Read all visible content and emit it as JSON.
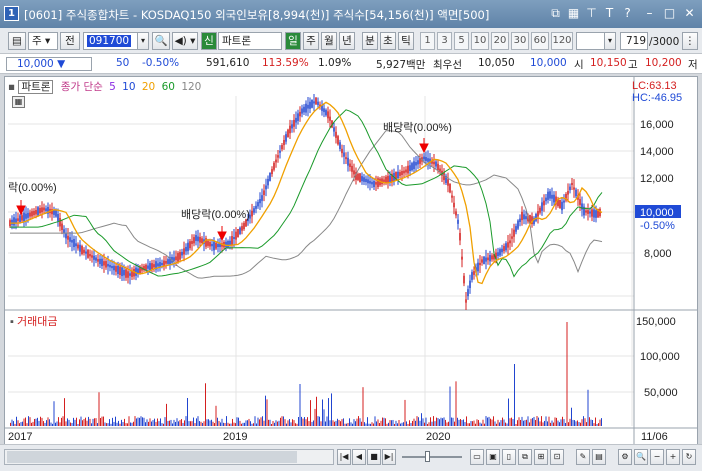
{
  "window": {
    "badge": "1",
    "title": "[0601] 주식종합차트 - KOSDAQ150 외국인보유[8,994(천)] 주식수[54,156(천)] 액면[500]"
  },
  "toolbar": {
    "market": "주",
    "market_select": "전",
    "code": "091700",
    "chart_type_badge": "신",
    "name": "파트론",
    "periods": [
      "일",
      "주",
      "월",
      "년",
      "분",
      "초",
      "틱"
    ],
    "intervals": [
      "1",
      "3",
      "5",
      "10",
      "20",
      "30",
      "60",
      "120"
    ],
    "count": "719",
    "total": "/3000"
  },
  "quote": {
    "price": "10,000",
    "change": "50",
    "change_pct": "-0.50%",
    "volume": "591,610",
    "volume_ratio": "113.59%",
    "turnover": "1.09%",
    "amount": "5,927백만",
    "best_bid_label": "최우선",
    "best_bid": "10,050",
    "best_ask": "10,000",
    "open_label": "시",
    "open": "10,150",
    "high_label": "고",
    "high": "10,200",
    "low_label": "저"
  },
  "chart": {
    "legend_name": "파트론",
    "legend_ma_label": "종가 단순",
    "legend_ma": [
      {
        "period": "5",
        "color": "#8a2be2"
      },
      {
        "period": "10",
        "color": "#1f4ad6"
      },
      {
        "period": "20",
        "color": "#f0a000"
      },
      {
        "period": "60",
        "color": "#1a9a2a"
      },
      {
        "period": "120",
        "color": "#888888"
      }
    ],
    "lc_label": "LC:63.13",
    "hc_label": "HC:-46.95",
    "current_price_tag": "10,000",
    "current_change_tag": "-0.50%",
    "price_axis": [
      "16,000",
      "14,000",
      "12,000",
      "10,000",
      "8,000"
    ],
    "volume_title": "거래대금",
    "volume_axis": [
      "150,000",
      "100,000",
      "50,000"
    ],
    "x_axis": [
      "2017",
      "2019",
      "2020",
      "11/06"
    ],
    "annotations": [
      "락(0.00%)",
      "배당락(0.00%)",
      "배당락(0.00%)"
    ]
  },
  "colors": {
    "up": "#d41f1f",
    "down": "#2145d0",
    "accent": "#0000ff"
  }
}
